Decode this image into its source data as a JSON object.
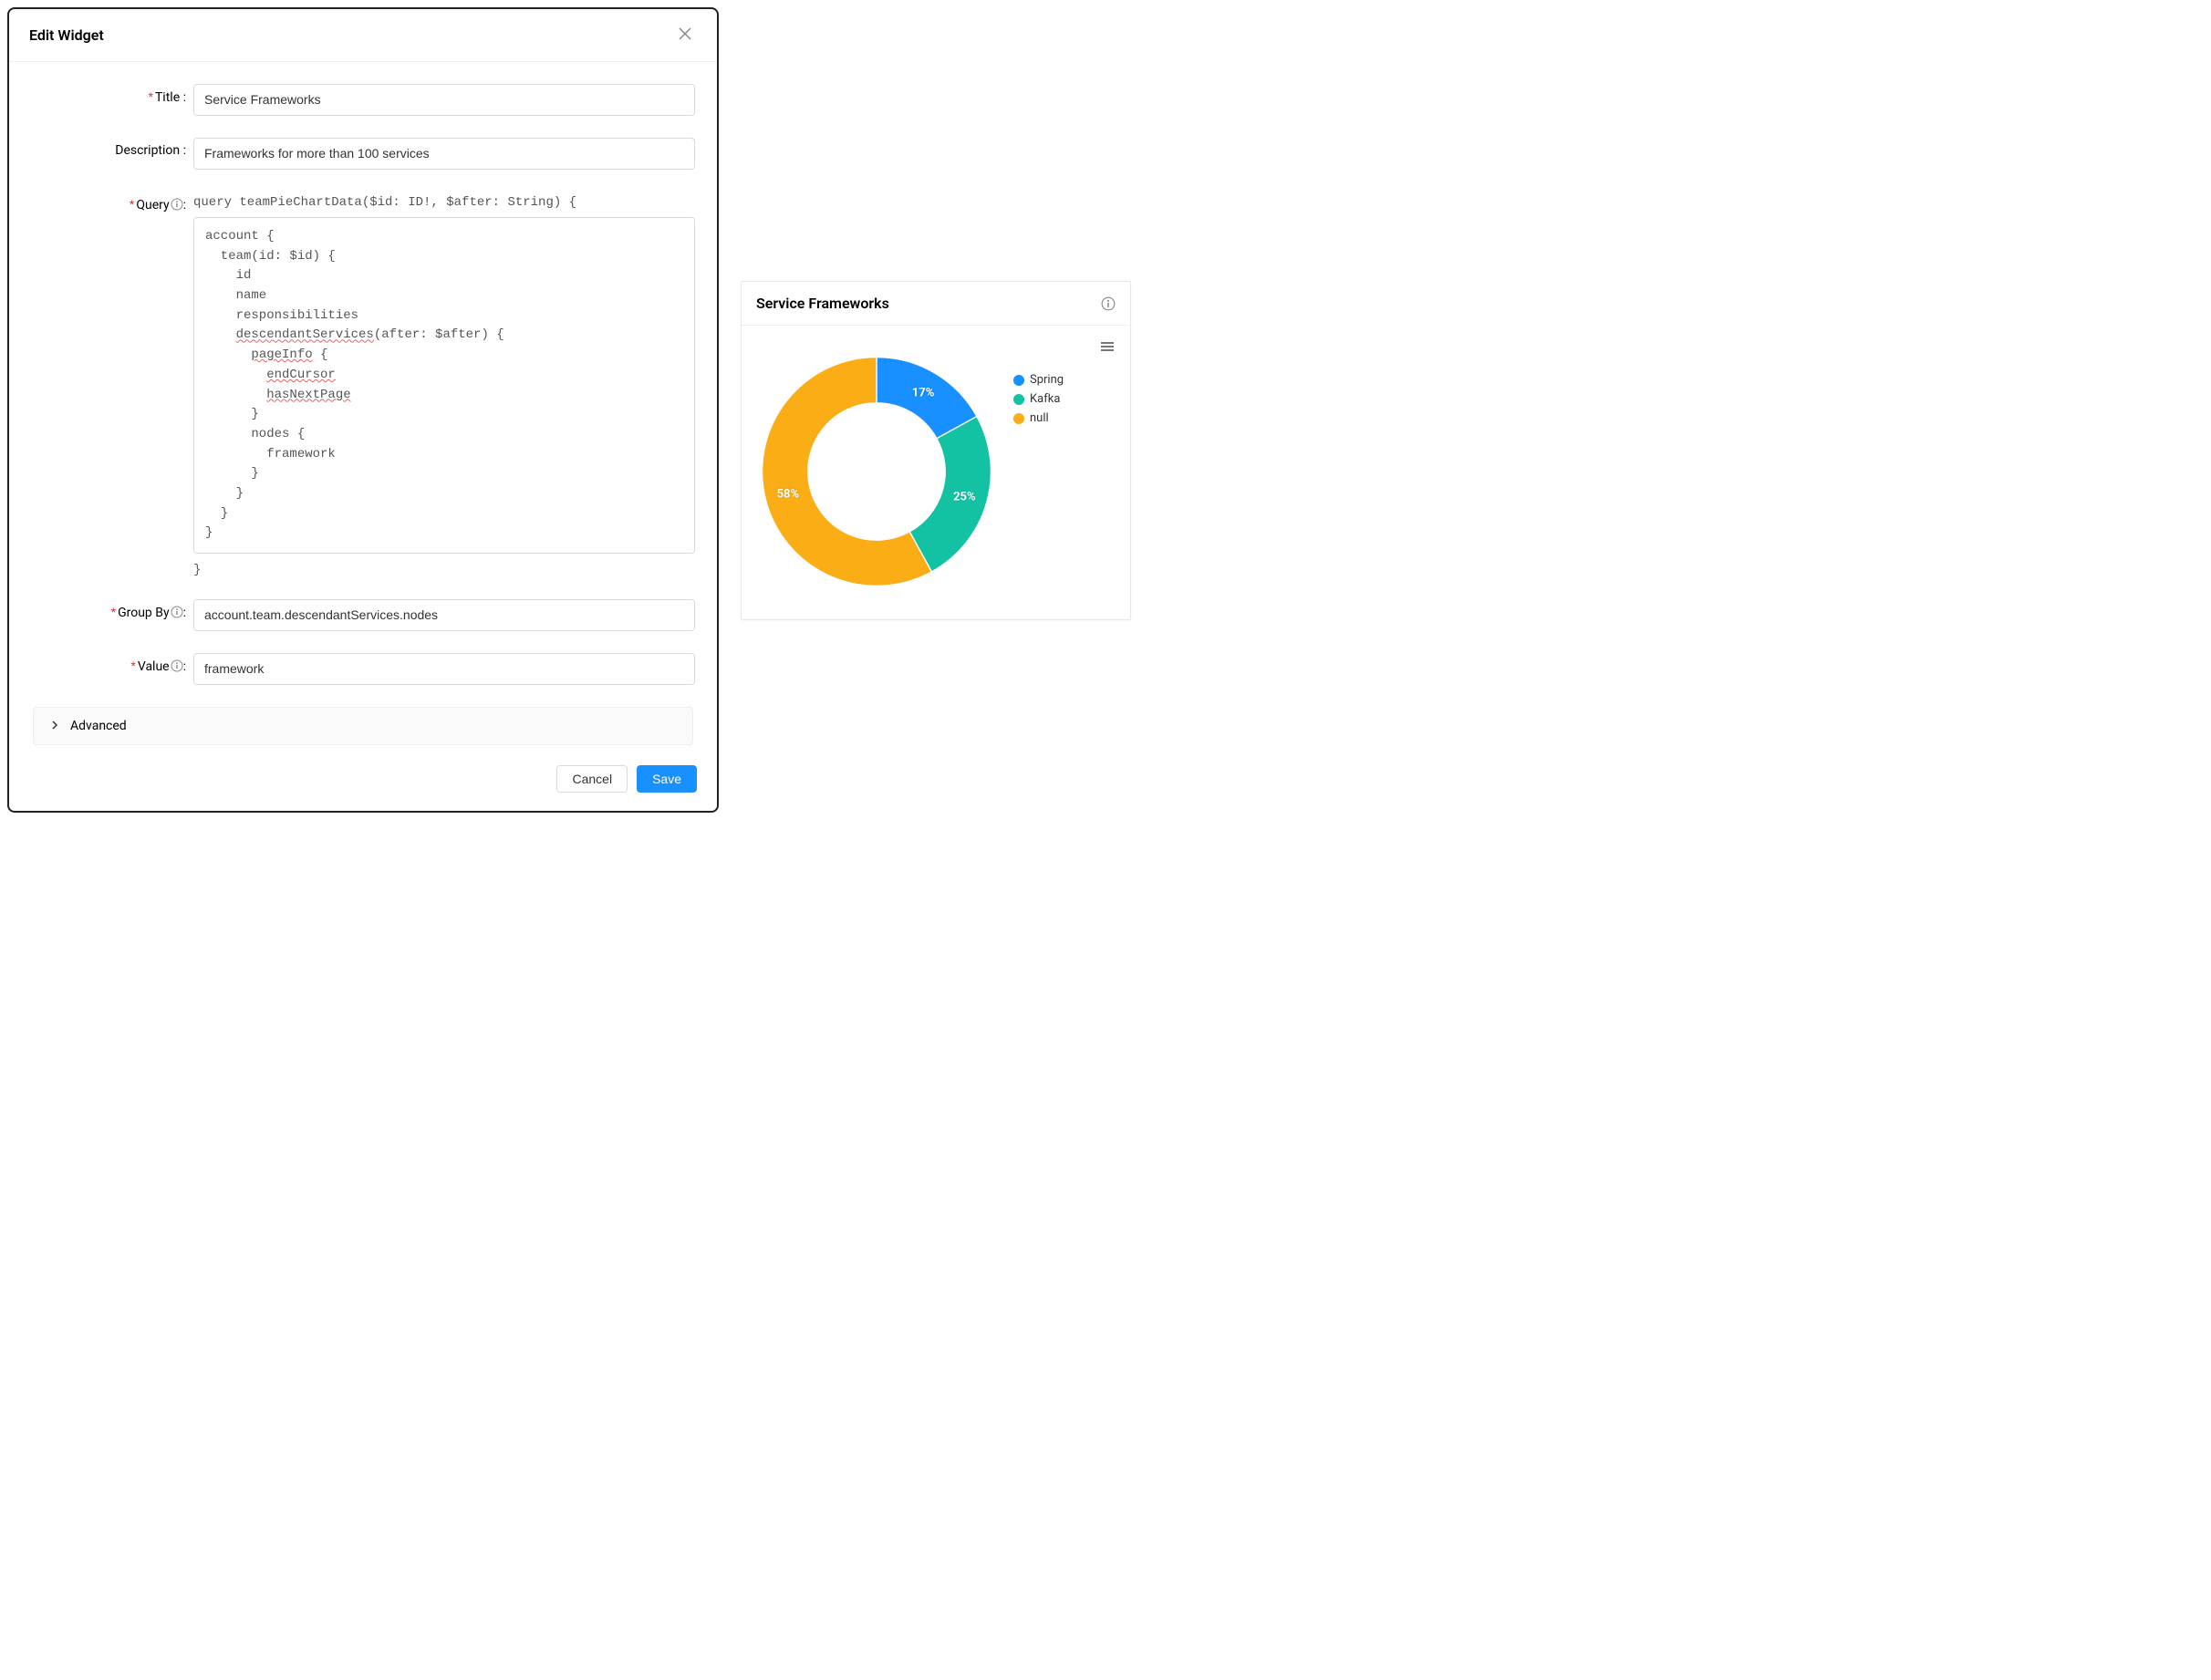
{
  "modal": {
    "title": "Edit Widget",
    "labels": {
      "title": "Title",
      "description": "Description",
      "query": "Query",
      "group_by": "Group By",
      "value": "Value"
    },
    "fields": {
      "title_value": "Service Frameworks",
      "description_value": "Frameworks for more than 100 services",
      "query_head": "query teamPieChartData($id: ID!, $after: String) {",
      "query_body_html": "account {\n  team(id: $id) {\n    id\n    name\n    responsibilities\n    <span class=\"sq\">descendantServices</span>(after: $after) {\n      <span class=\"sq\">pageInfo</span> {\n        <span class=\"sq\">endCursor</span>\n        <span class=\"sq\">hasNextPage</span>\n      }\n      nodes {\n        framework\n      }\n    }\n  }\n}",
      "query_tail": "}",
      "group_by_value": "account.team.descendantServices.nodes",
      "value_value": "framework"
    },
    "advanced_label": "Advanced",
    "buttons": {
      "cancel": "Cancel",
      "save": "Save"
    }
  },
  "preview": {
    "title": "Service Frameworks",
    "chart_data": {
      "type": "pie",
      "title": "Service Frameworks",
      "series": [
        {
          "name": "Spring",
          "value": 17,
          "label": "17%",
          "color": "#1890ff"
        },
        {
          "name": "Kafka",
          "value": 25,
          "label": "25%",
          "color": "#13c2a3"
        },
        {
          "name": "null",
          "value": 58,
          "label": "58%",
          "color": "#faad14"
        }
      ]
    }
  },
  "chart_data": {
    "type": "pie",
    "title": "Service Frameworks",
    "categories": [
      "Spring",
      "Kafka",
      "null"
    ],
    "values": [
      17,
      25,
      58
    ],
    "colors": [
      "#1890ff",
      "#13c2a3",
      "#faad14"
    ],
    "legend_position": "right"
  }
}
